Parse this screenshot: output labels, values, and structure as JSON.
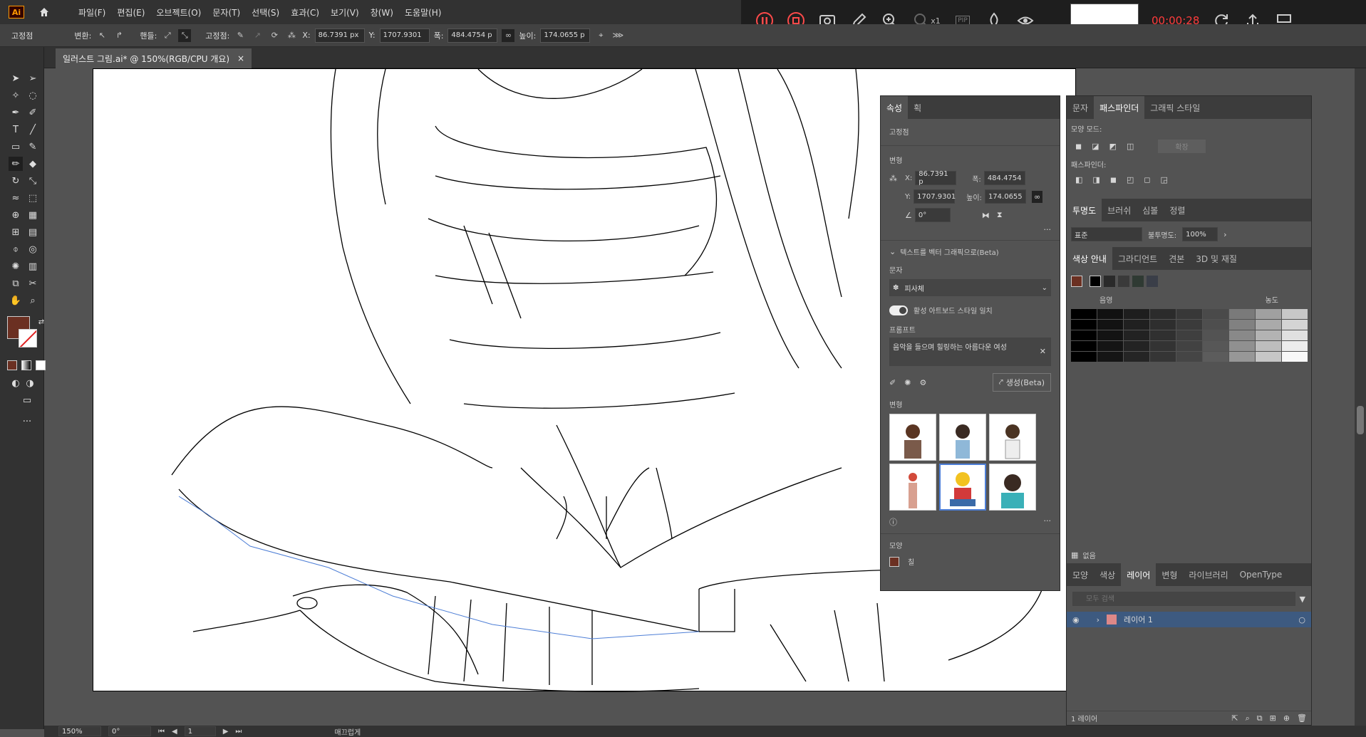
{
  "app": {
    "logo": "Ai"
  },
  "menu": [
    "파일(F)",
    "편집(E)",
    "오브젝트(O)",
    "문자(T)",
    "선택(S)",
    "효과(C)",
    "보기(V)",
    "창(W)",
    "도움말(H)"
  ],
  "control_bar": {
    "anchor_label": "고정점",
    "convert_label": "변환:",
    "handle_label": "핸들:",
    "anchor2_label": "고정점:",
    "x_label": "X:",
    "x_value": "86.7391 px",
    "y_label": "Y:",
    "y_value": "1707.9301",
    "w_label": "폭:",
    "w_value": "484.4754 p",
    "h_label": "높이:",
    "h_value": "174.0655 p"
  },
  "recorder": {
    "time": "00:00:28",
    "zoom_level": "x1",
    "pip": "PIP"
  },
  "document_tab": {
    "title": "일러스트 그림.ai* @ 150%(RGB/CPU 개요)",
    "close": "×"
  },
  "status_bar": {
    "zoom": "150%",
    "rotation": "0°",
    "artboard": "1",
    "mode": "매끄럽게"
  },
  "properties_panel": {
    "tabs": [
      "속성",
      "획"
    ],
    "anchor_title": "고정점",
    "transform_title": "변형",
    "x_label": "X:",
    "x_value": "86.7391 p",
    "y_label": "Y:",
    "y_value": "1707.9301",
    "w_label": "폭:",
    "w_value": "484.4754",
    "h_label": "높이:",
    "h_value": "174.0655",
    "angle_value": "0°",
    "text_to_vector_title": "텍스트를 벡터 그래픽으로(Beta)",
    "subject_label": "문자",
    "subject_value": "피사체",
    "match_style_label": "활성 아트보드 스타일 일치",
    "prompt_label": "프롬프트",
    "prompt_value": "음악을 들으며 힐링하는 아름다운  여성",
    "generate_label": "생성(Beta)",
    "variations_label": "변형",
    "appearance_title": "모양",
    "fill_label": "칠"
  },
  "pathfinder_panel": {
    "tabs": [
      "문자",
      "패스파인더",
      "그래픽 스타일"
    ],
    "shape_modes_label": "모양 모드:",
    "expand_label": "확장",
    "pathfinder_label": "패스파인더:"
  },
  "transparency_panel": {
    "tabs": [
      "투명도",
      "브러쉬",
      "심볼",
      "정렬"
    ],
    "mode": "표준",
    "opacity_label": "불투명도:",
    "opacity_value": "100%"
  },
  "color_guide_panel": {
    "tabs": [
      "색상 안내",
      "그라디언트",
      "견본",
      "3D 및 재질"
    ],
    "shades_label": "음영",
    "tints_label": "농도",
    "none_label": "없음"
  },
  "layers_panel": {
    "tabs": [
      "모양",
      "색상",
      "레이어",
      "변형",
      "라이브러리",
      "OpenType"
    ],
    "search_placeholder": "모두 검색",
    "layer_name": "레이어 1",
    "footer": "1 레이어"
  },
  "colors": {
    "fill": "#6b3022",
    "accent": "#4d7ed6"
  }
}
